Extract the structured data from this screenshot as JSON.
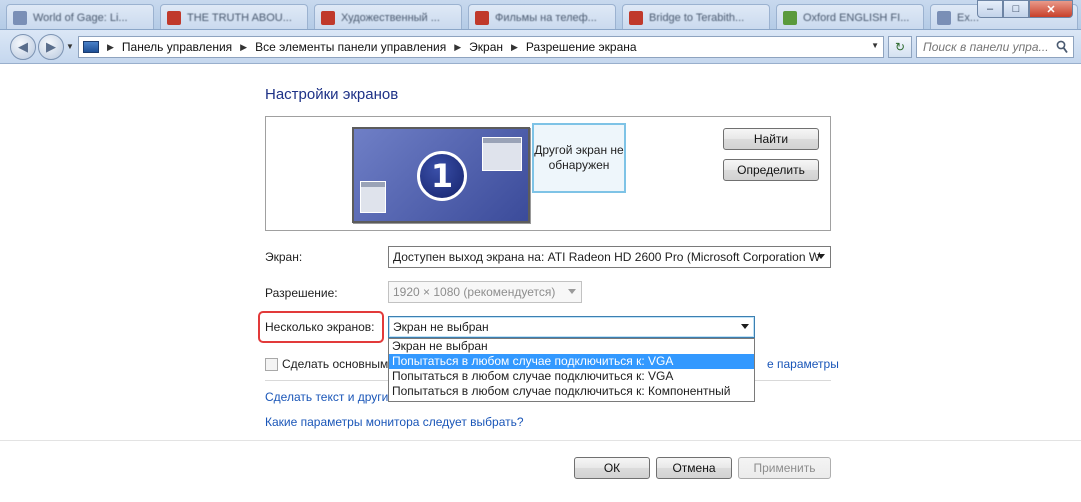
{
  "browser_tabs": [
    {
      "title": "World of Gage: Li...",
      "color": "#7a8fb6"
    },
    {
      "title": "THE TRUTH ABOU...",
      "color": "#c0392b"
    },
    {
      "title": "Художественный ...",
      "color": "#c0392b"
    },
    {
      "title": "Фильмы на телеф...",
      "color": "#c0392b"
    },
    {
      "title": "Bridge to Terabith...",
      "color": "#c0392b"
    },
    {
      "title": "Oxford ENGLISH FI...",
      "color": "#5a9a3c"
    },
    {
      "title": "Ex...",
      "color": "#7a8fb6"
    }
  ],
  "window_controls": {
    "minimize": "‒",
    "maximize": "□",
    "close": "✕"
  },
  "address_bar": {
    "breadcrumbs": [
      "Панель управления",
      "Все элементы панели управления",
      "Экран",
      "Разрешение экрана"
    ],
    "search_placeholder": "Поиск в панели упра..."
  },
  "main": {
    "title": "Настройки экранов",
    "other_display_text": "Другой экран не обнаружен",
    "monitor_number": "1",
    "find_button": "Найти",
    "identify_button": "Определить",
    "display_label": "Экран:",
    "display_value": "Доступен выход экрана на: ATI Radeon HD 2600 Pro (Microsoft Corporation W",
    "resolution_label": "Разрешение:",
    "resolution_value": "1920 × 1080 (рекомендуется)",
    "multiple_displays_label": "Несколько экранов:",
    "multiple_displays_value": "Экран не выбран",
    "multiple_displays_options": [
      "Экран не выбран",
      "Попытаться в любом случае подключиться к: VGA",
      "Попытаться в любом случае подключиться к: VGA",
      "Попытаться в любом случае подключиться к: Компонентный"
    ],
    "selected_option_index": 1,
    "checkbox_label": "Сделать основным",
    "advanced_link": "е параметры",
    "text_size_link": "Сделать текст и други",
    "monitor_params_link": "Какие параметры монитора следует выбрать?"
  },
  "footer": {
    "ok": "ОК",
    "cancel": "Отмена",
    "apply": "Применить"
  }
}
